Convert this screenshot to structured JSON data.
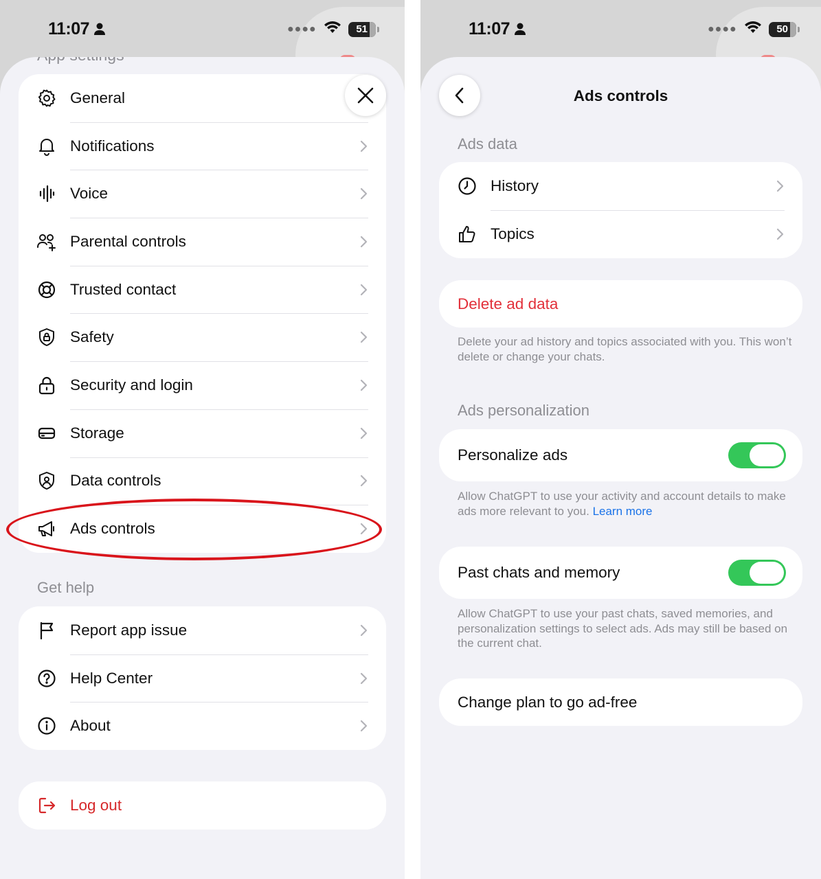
{
  "status_bar": [
    {
      "time": "11:07",
      "battery": "51"
    },
    {
      "time": "11:07",
      "battery": "50"
    }
  ],
  "settings": {
    "app_settings_heading": "App settings",
    "app_items": [
      {
        "label": "General",
        "icon": "gear-icon"
      },
      {
        "label": "Notifications",
        "icon": "bell-icon"
      },
      {
        "label": "Voice",
        "icon": "voice-waveform-icon"
      },
      {
        "label": "Parental controls",
        "icon": "people-add-icon"
      },
      {
        "label": "Trusted contact",
        "icon": "lifebuoy-icon"
      },
      {
        "label": "Safety",
        "icon": "shield-lock-icon"
      },
      {
        "label": "Security and login",
        "icon": "padlock-icon"
      },
      {
        "label": "Storage",
        "icon": "storage-drive-icon"
      },
      {
        "label": "Data controls",
        "icon": "shield-person-icon"
      },
      {
        "label": "Ads controls",
        "icon": "megaphone-icon"
      }
    ],
    "get_help_heading": "Get help",
    "help_items": [
      {
        "label": "Report app issue",
        "icon": "flag-icon"
      },
      {
        "label": "Help Center",
        "icon": "question-circle-icon"
      },
      {
        "label": "About",
        "icon": "info-circle-icon"
      }
    ],
    "logout_label": "Log out",
    "logout_color": "#d6282a",
    "highlight_color": "#d9141b"
  },
  "ads": {
    "title": "Ads controls",
    "ads_data_heading": "Ads data",
    "ads_data_items": [
      {
        "label": "History",
        "icon": "clock-icon"
      },
      {
        "label": "Topics",
        "icon": "thumbs-up-icon"
      }
    ],
    "delete_label": "Delete ad data",
    "delete_note": "Delete your ad history and topics associated with you. This won’t delete or change your chats.",
    "personalization_heading": "Ads personalization",
    "personalize_label": "Personalize ads",
    "personalize_on": true,
    "personalize_note": "Allow ChatGPT to use your activity and account details to make ads more relevant to you.",
    "learn_more": "Learn more",
    "past_chats_label": "Past chats and memory",
    "past_chats_on": true,
    "past_chats_note": "Allow ChatGPT to use your past chats, saved memories, and personalization settings to select ads. Ads may still be based on the current chat.",
    "change_plan_label": "Change plan to go ad-free",
    "toggle_color": "#34c759",
    "delete_color": "#e2303a",
    "link_color": "#1a73e8"
  }
}
